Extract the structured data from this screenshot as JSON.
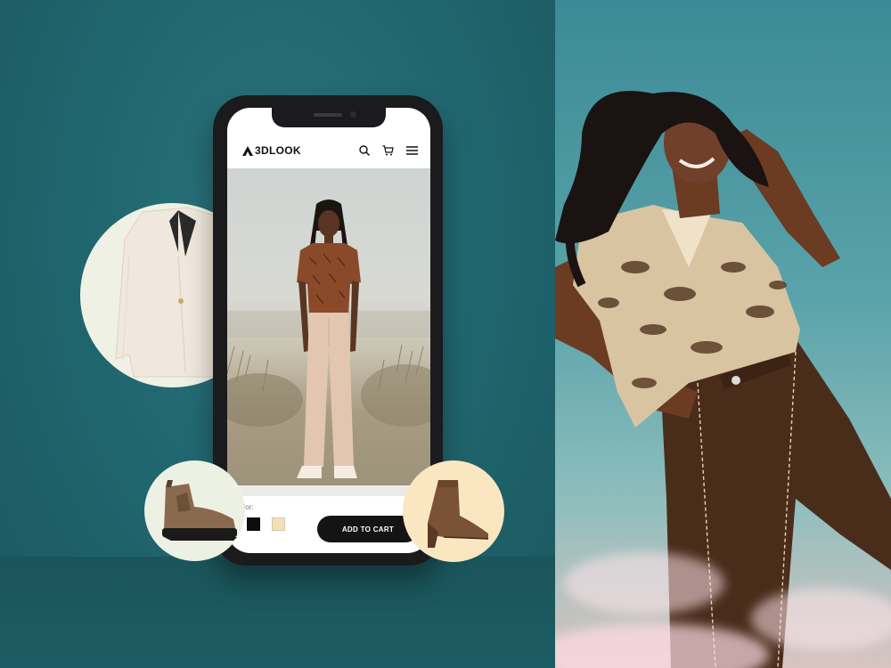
{
  "app": {
    "brand": "3DLOOK",
    "header_icons": [
      "search-icon",
      "cart-icon",
      "hamburger-menu-icon"
    ]
  },
  "product": {
    "color_label": "olor:",
    "swatches": [
      "#0d0d0d",
      "#f3e0b8"
    ],
    "add_to_cart_label": "ADD TO CART"
  },
  "colors": {
    "background_teal": "#216770",
    "button_dark": "#141414",
    "circle_mint": "#eef1e4",
    "circle_cream": "#fbe6c2"
  }
}
